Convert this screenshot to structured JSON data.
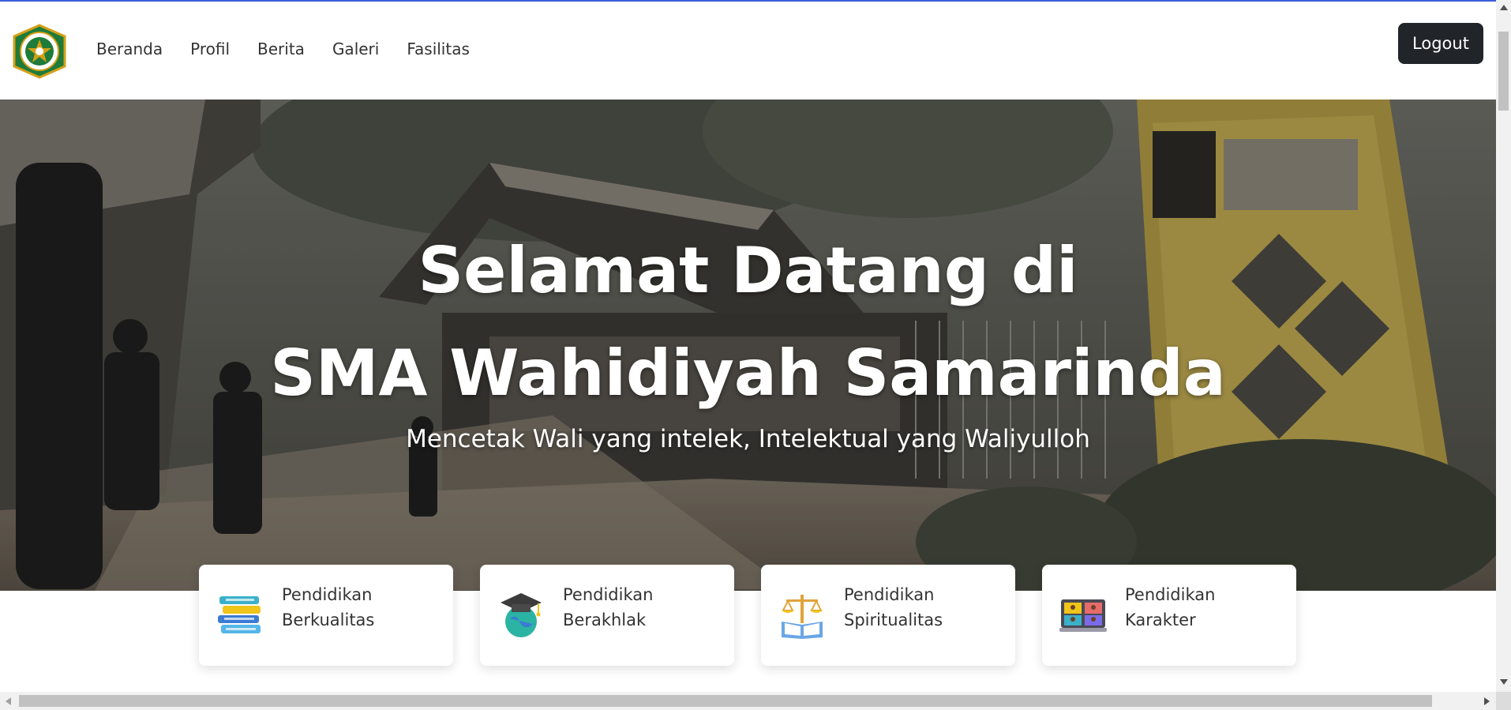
{
  "nav": {
    "links": [
      "Beranda",
      "Profil",
      "Berita",
      "Galeri",
      "Fasilitas"
    ],
    "logout_label": "Logout"
  },
  "hero": {
    "title_line1": "Selamat Datang di",
    "title_line2": "SMA Wahidiyah Samarinda",
    "subtitle": "Mencetak Wali yang intelek, Intelektual yang Waliyulloh"
  },
  "features": [
    {
      "line1": "Pendidikan",
      "line2": "Berkualitas",
      "icon": "books-icon"
    },
    {
      "line1": "Pendidikan",
      "line2": "Berakhlak",
      "icon": "graduation-globe-icon"
    },
    {
      "line1": "Pendidikan",
      "line2": "Spiritualitas",
      "icon": "scale-book-icon"
    },
    {
      "line1": "Pendidikan",
      "line2": "Karakter",
      "icon": "video-class-icon"
    }
  ],
  "colors": {
    "accent_line": "#3b5bdb",
    "logout_bg": "#212529",
    "logo_green": "#1e7b3a",
    "logo_gold": "#d4a017"
  }
}
